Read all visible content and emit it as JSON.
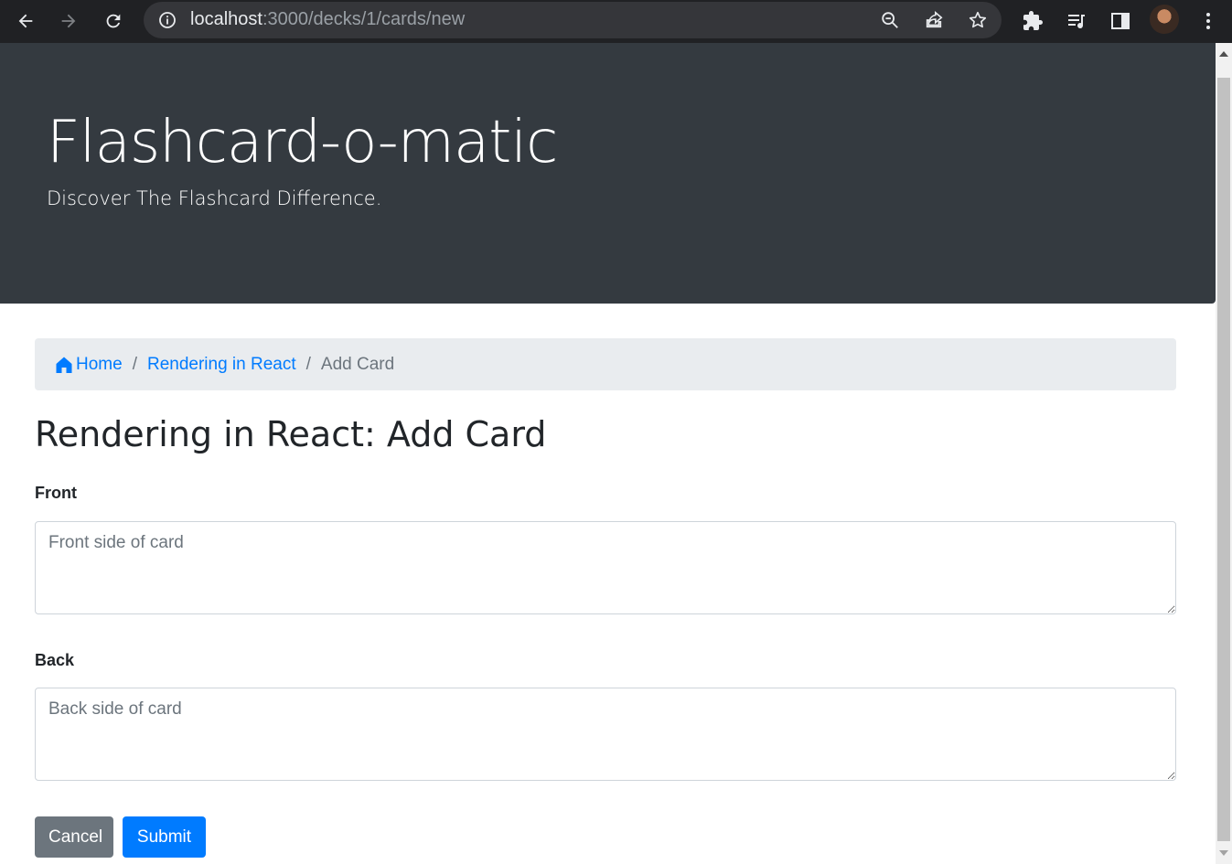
{
  "browser": {
    "url_host": "localhost",
    "url_rest": ":3000/decks/1/cards/new",
    "icons": [
      "back-arrow-icon",
      "forward-arrow-icon",
      "reload-icon",
      "info-icon",
      "zoom-icon",
      "share-icon",
      "star-icon",
      "extensions-icon",
      "media-icon",
      "side-panel-icon",
      "profile-avatar",
      "kebab-menu-icon"
    ]
  },
  "header": {
    "title": "Flashcard-o-matic",
    "lead": "Discover The Flashcard Difference."
  },
  "breadcrumb": {
    "home": "Home",
    "deck": "Rendering in React",
    "current": "Add Card",
    "separator": "/"
  },
  "page": {
    "title": "Rendering in React: Add Card"
  },
  "form": {
    "front_label": "Front",
    "front_placeholder": "Front side of card",
    "back_label": "Back",
    "back_placeholder": "Back side of card",
    "cancel_label": "Cancel",
    "submit_label": "Submit"
  },
  "colors": {
    "jumbotron": "#343a40",
    "link": "#007bff",
    "cancel": "#6c757d",
    "submit": "#007bff"
  }
}
